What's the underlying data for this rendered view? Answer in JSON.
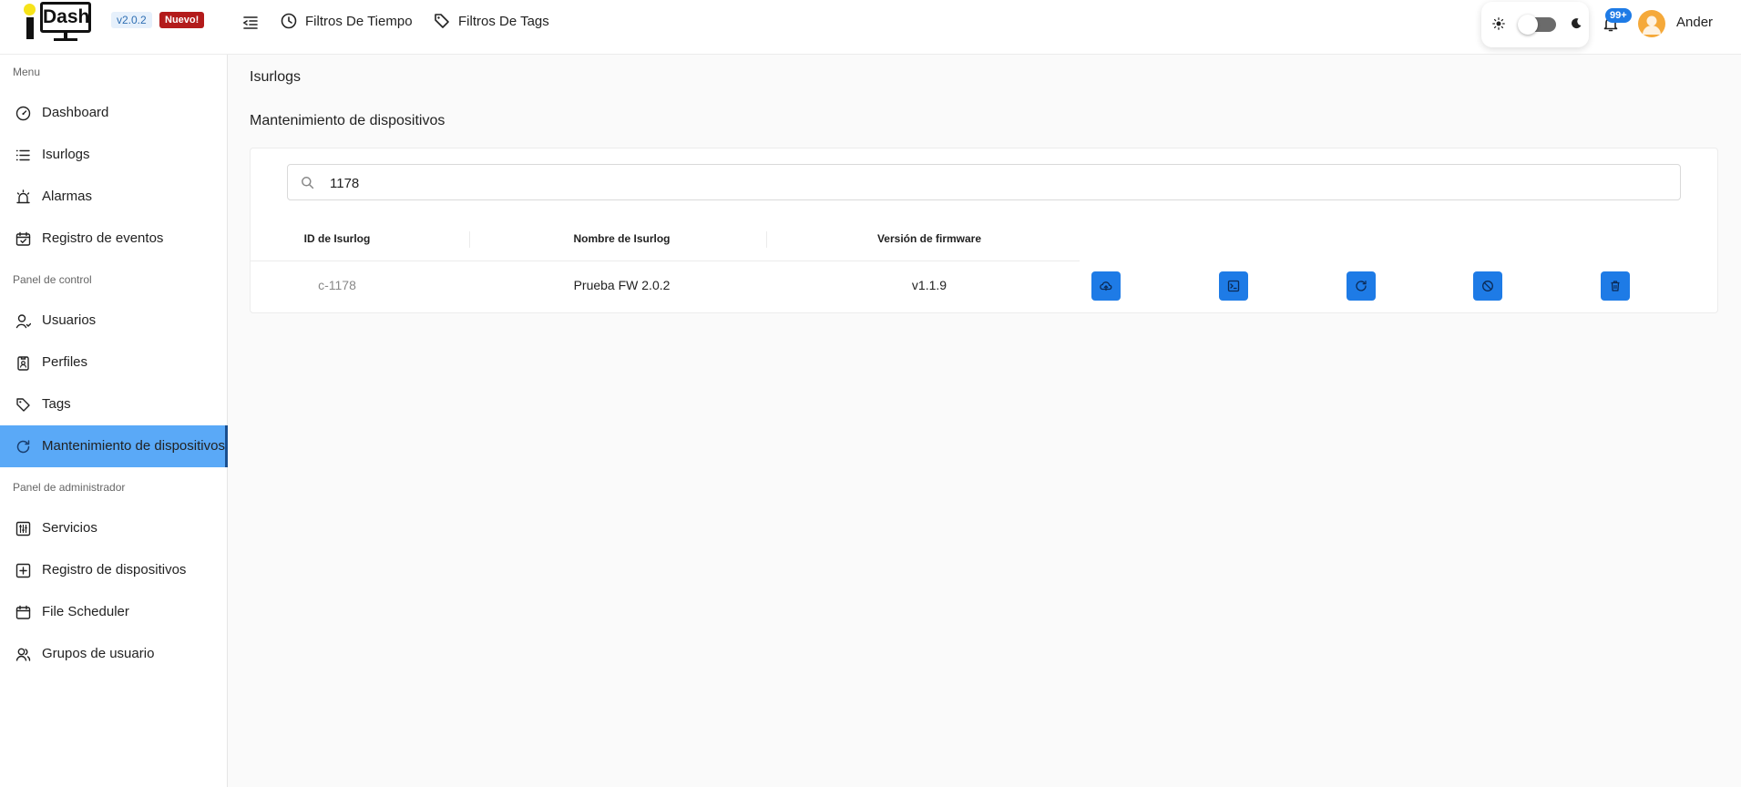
{
  "app": {
    "logo_text": "Dash",
    "version": "v2.0.2",
    "new_badge": "Nuevo!"
  },
  "topnav": {
    "time_filters": "Filtros De Tiempo",
    "tag_filters": "Filtros De Tags"
  },
  "header": {
    "notifications_count": "99+",
    "user_name": "Ander"
  },
  "sidebar": {
    "sections": [
      {
        "label": "Menu"
      },
      {
        "label": "Panel de control"
      },
      {
        "label": "Panel de administrador"
      }
    ],
    "items": [
      {
        "label": "Dashboard",
        "icon": "gauge-icon"
      },
      {
        "label": "Isurlogs",
        "icon": "list-icon"
      },
      {
        "label": "Alarmas",
        "icon": "siren-icon"
      },
      {
        "label": "Registro de eventos",
        "icon": "calendar-check-icon"
      },
      {
        "label": "Usuarios",
        "icon": "user-icon"
      },
      {
        "label": "Perfiles",
        "icon": "badge-icon"
      },
      {
        "label": "Tags",
        "icon": "tag-icon"
      },
      {
        "label": "Mantenimiento de dispositivos",
        "icon": "refresh-icon",
        "active": true
      },
      {
        "label": "Servicios",
        "icon": "sliders-icon"
      },
      {
        "label": "Registro de dispositivos",
        "icon": "plus-square-icon"
      },
      {
        "label": "File Scheduler",
        "icon": "calendar-icon"
      },
      {
        "label": "Grupos de usuario",
        "icon": "users-icon"
      }
    ]
  },
  "main": {
    "breadcrumb": "Isurlogs",
    "title": "Mantenimiento de dispositivos",
    "search": {
      "value": "1178"
    },
    "table": {
      "columns": [
        "ID de Isurlog",
        "Nombre de Isurlog",
        "Versión de firmware"
      ],
      "rows": [
        {
          "id": "c-1178",
          "name": "Prueba FW 2.0.2",
          "firmware": "v1.1.9"
        }
      ],
      "actions": [
        "cloud-upload-icon",
        "terminal-icon",
        "refresh-icon",
        "ban-icon",
        "trash-icon"
      ]
    }
  },
  "colors": {
    "accent": "#1e7be6",
    "active_item": "#5aa9f7",
    "new_badge": "#b31b1b",
    "avatar": "#f5a93a"
  }
}
